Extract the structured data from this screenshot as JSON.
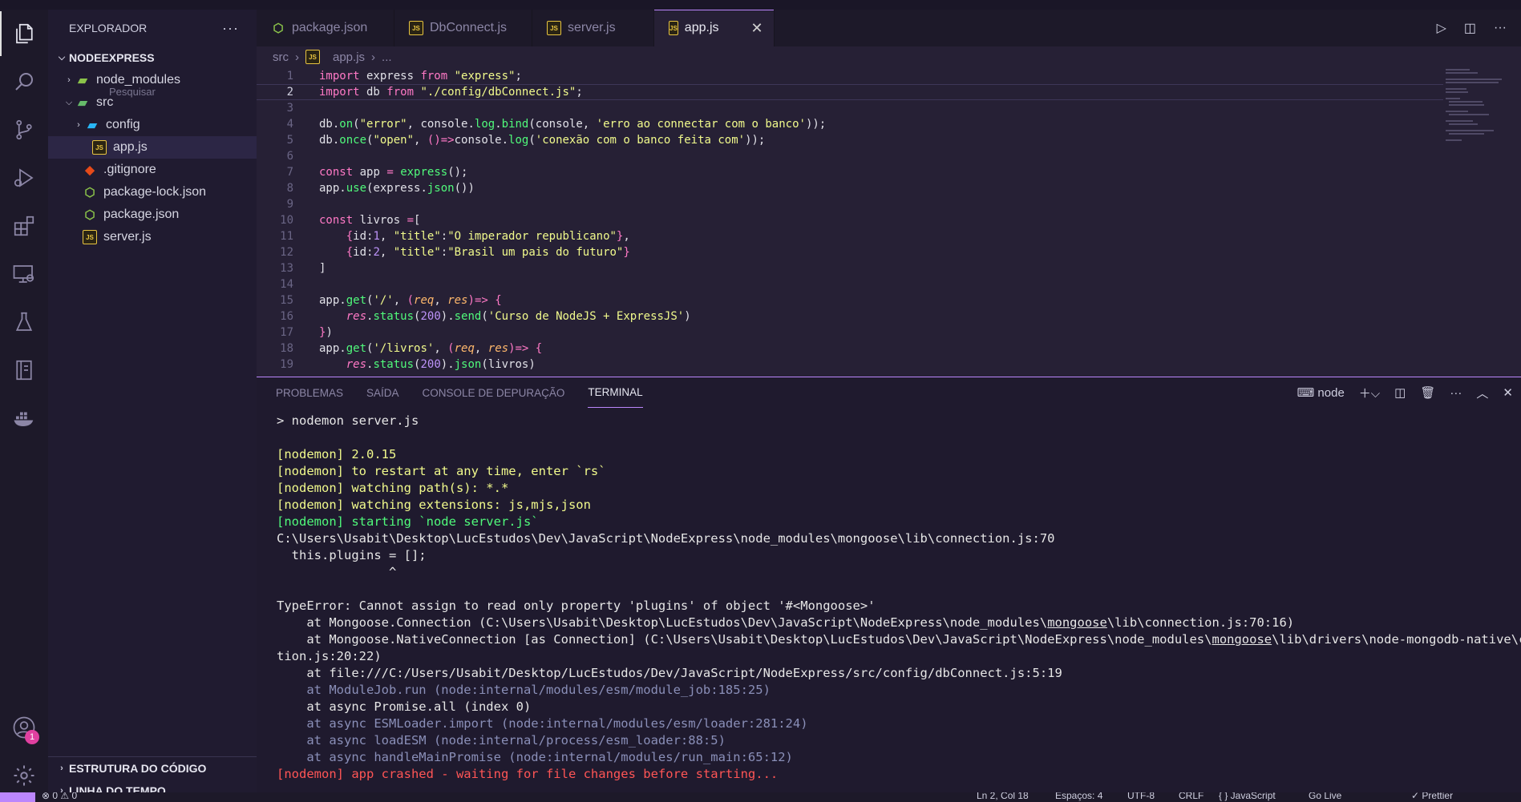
{
  "sidebar": {
    "title": "EXPLORADOR",
    "more_label": "···",
    "project": "NODEEXPRESS",
    "hover_tip": "Pesquisar",
    "tree": [
      {
        "label": "node_modules"
      },
      {
        "label": "src"
      },
      {
        "label": "config"
      },
      {
        "label": "app.js"
      },
      {
        "label": ".gitignore"
      },
      {
        "label": "package-lock.json"
      },
      {
        "label": "package.json"
      },
      {
        "label": "server.js"
      }
    ],
    "outline": "ESTRUTURA DO CÓDIGO",
    "timeline": "LINHA DO TEMPO"
  },
  "activity": {
    "accounts_badge": "1"
  },
  "tabs": [
    {
      "label": "package.json"
    },
    {
      "label": "DbConnect.js"
    },
    {
      "label": "server.js"
    },
    {
      "label": "app.js",
      "close": "✕"
    }
  ],
  "breadcrumb": {
    "part1": "src",
    "part2": "app.js",
    "part3": "..."
  },
  "panel": {
    "tabs": [
      "PROBLEMAS",
      "SAÍDA",
      "CONSOLE DE DEPURAÇÃO",
      "TERMINAL"
    ],
    "shell": "node"
  },
  "terminal": {
    "prompt": "> nodemon server.js",
    "l1": "[nodemon] 2.0.15",
    "l2": "[nodemon] to restart at any time, enter `rs`",
    "l3": "[nodemon] watching path(s): *.*",
    "l4": "[nodemon] watching extensions: js,mjs,json",
    "l5": "[nodemon] starting `node server.js`",
    "l6": "C:\\Users\\Usabit\\Desktop\\LucEstudos\\Dev\\JavaScript\\NodeExpress\\node_modules\\mongoose\\lib\\connection.js:70",
    "l7": "  this.plugins = [];",
    "l8": "               ^",
    "l9": "TypeError: Cannot assign to read only property 'plugins' of object '#<Mongoose>'",
    "l10a": "    at Mongoose.Connection (C:\\Users\\Usabit\\Desktop\\LucEstudos\\Dev\\JavaScript\\NodeExpress\\node_modules\\",
    "l10b": "mongoose",
    "l10c": "\\lib\\connection.js:70:16)",
    "l11a": "    at Mongoose.NativeConnection [as Connection] (C:\\Users\\Usabit\\Desktop\\LucEstudos\\Dev\\JavaScript\\NodeExpress\\node_modules\\",
    "l11b": "mongoose",
    "l11c": "\\lib\\drivers\\node-mongodb-native\\connec",
    "l12": "tion.js:20:22)",
    "l13": "    at file:///C:/Users/Usabit/Desktop/LucEstudos/Dev/JavaScript/NodeExpress/src/config/dbConnect.js:5:19",
    "l14": "    at ModuleJob.run (node:internal/modules/esm/module_job:185:25)",
    "l15": "    at async Promise.all (index 0)",
    "l16": "    at async ESMLoader.import (node:internal/modules/esm/loader:281:24)",
    "l17": "    at async loadESM (node:internal/process/esm_loader:88:5)",
    "l18": "    at async handleMainPromise (node:internal/modules/run_main:65:12)",
    "l19": "[nodemon] app crashed - waiting for file changes before starting..."
  },
  "statusbar": {
    "errors": "⊗ 0 ⚠ 0",
    "position": "Ln 2, Col 18",
    "spaces": "Espaços: 4",
    "encoding": "UTF-8",
    "eol": "CRLF",
    "language": "{ } JavaScript",
    "golive": "Go Live",
    "prettier": "✓ Prettier"
  },
  "colors": {
    "accent": "#bb86fc",
    "background": "#262035"
  }
}
